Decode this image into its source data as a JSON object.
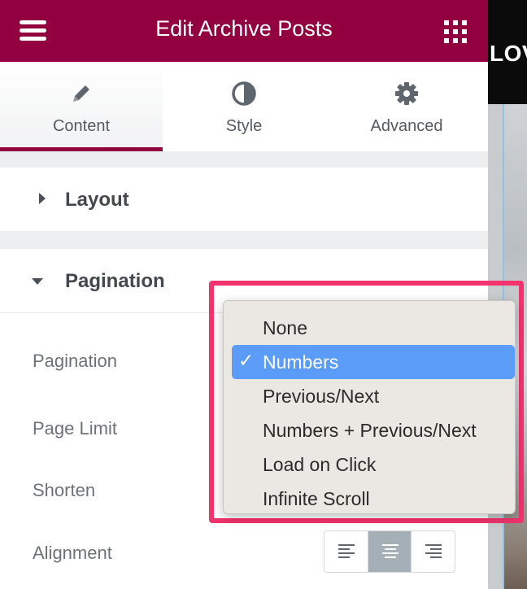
{
  "header": {
    "title": "Edit Archive Posts"
  },
  "tabs": [
    {
      "label": "Content",
      "icon": "pencil-icon",
      "active": true
    },
    {
      "label": "Style",
      "icon": "half-circle-icon",
      "active": false
    },
    {
      "label": "Advanced",
      "icon": "gear-icon",
      "active": false
    }
  ],
  "sections": {
    "layout": {
      "title": "Layout",
      "expanded": false
    },
    "pagination": {
      "title": "Pagination",
      "expanded": true
    }
  },
  "fields": {
    "pagination_label": "Pagination",
    "page_limit_label": "Page Limit",
    "shorten_label": "Shorten",
    "alignment_label": "Alignment"
  },
  "alignment": {
    "options": [
      "left",
      "center",
      "right"
    ],
    "selected": "center"
  },
  "dropdown": {
    "options": [
      "None",
      "Numbers",
      "Previous/Next",
      "Numbers + Previous/Next",
      "Load on Click",
      "Infinite Scroll"
    ],
    "selected": "Numbers",
    "check_glyph": "✓"
  },
  "preview": {
    "text": "LOV"
  },
  "colors": {
    "brand": "#93003f",
    "highlight": "#f4336e",
    "selection": "#5a9cf8"
  }
}
